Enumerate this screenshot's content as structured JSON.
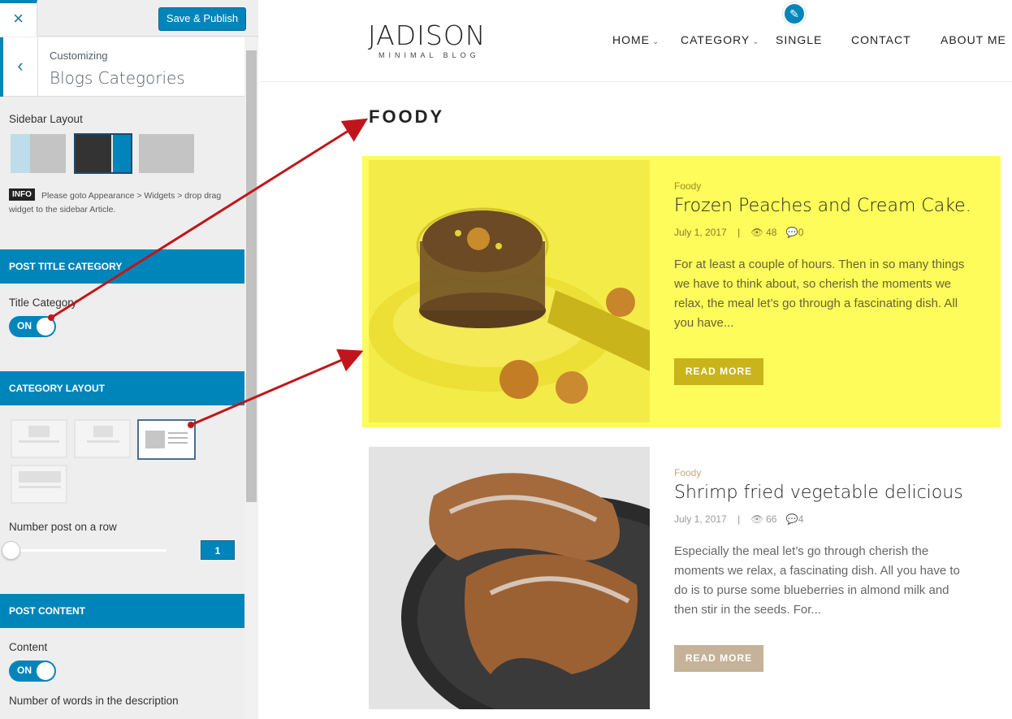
{
  "customizer": {
    "close_icon": "×",
    "publish_label": "Save & Publish",
    "back_icon": "‹",
    "crumb_small": "Customizing",
    "crumb_title": "Blogs Categories",
    "sidebar_layout_label": "Sidebar Layout",
    "info_tag": "INFO",
    "info_text": "Please goto Appearance > Widgets > drop drag widget to the sidebar Article.",
    "section_post_title": "POST TITLE CATEGORY",
    "title_category_label": "Title Category",
    "title_category_toggle": "ON",
    "section_category_layout": "CATEGORY LAYOUT",
    "number_post_label": "Number post on a row",
    "number_post_value": "1",
    "section_post_content": "POST CONTENT",
    "content_label": "Content",
    "content_toggle": "ON",
    "words_label": "Number of words in the description"
  },
  "site": {
    "logo": "JADISON",
    "tagline": "MINIMAL BLOG",
    "nav": [
      "HOME",
      "CATEGORY",
      "SINGLE",
      "CONTACT",
      "ABOUT ME"
    ],
    "category_heading": "FOODY"
  },
  "posts": [
    {
      "category": "Foody",
      "title": "Frozen Peaches and Cream Cake.",
      "date": "July 1, 2017",
      "views": "48",
      "comments": "0",
      "excerpt": "For at least a couple of hours. Then in so many things we have to think about, so cherish the moments we relax, the meal let’s go through a fascinating dish. All you have...",
      "button": "READ MORE"
    },
    {
      "category": "Foody",
      "title": "Shrimp fried vegetable delicious",
      "date": "July 1, 2017",
      "views": "66",
      "comments": "4",
      "excerpt": "Especially the meal let’s go through cherish the moments we relax, a fascinating dish. All you have to do is to purse some blueberries in almond milk and then stir in the seeds. For...",
      "button": "READ MORE"
    }
  ],
  "colors": {
    "accent": "#0085ba",
    "highlight": "#fdfc5a",
    "arrow": "#c0161b"
  }
}
